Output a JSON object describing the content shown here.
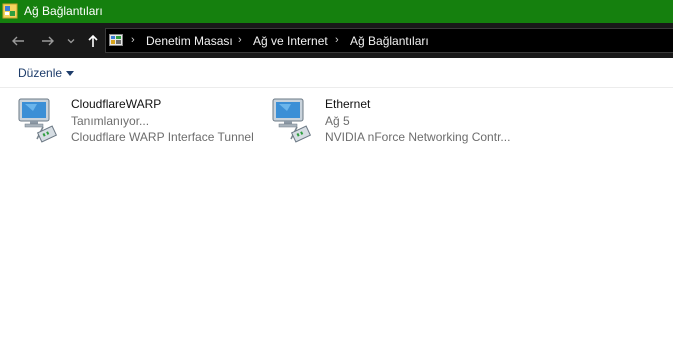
{
  "window": {
    "title": "Ağ Bağlantıları"
  },
  "breadcrumb": [
    "Denetim Masası",
    "Ağ ve Internet",
    "Ağ Bağlantıları"
  ],
  "toolbar": {
    "organize_label": "Düzenle"
  },
  "connections": [
    {
      "name": "CloudflareWARP",
      "status": "Tanımlanıyor...",
      "device": "Cloudflare WARP Interface Tunnel"
    },
    {
      "name": "Ethernet",
      "status": "Ağ 5",
      "device": "NVIDIA nForce Networking Contr..."
    }
  ],
  "colors": {
    "titlebar": "#15800e",
    "navbar": "#191919",
    "link": "#1e3d6b"
  },
  "icons": [
    "back-arrow-icon",
    "forward-arrow-icon",
    "recent-dropdown-icon",
    "up-arrow-icon",
    "control-panel-icon",
    "network-adapter-icon"
  ]
}
